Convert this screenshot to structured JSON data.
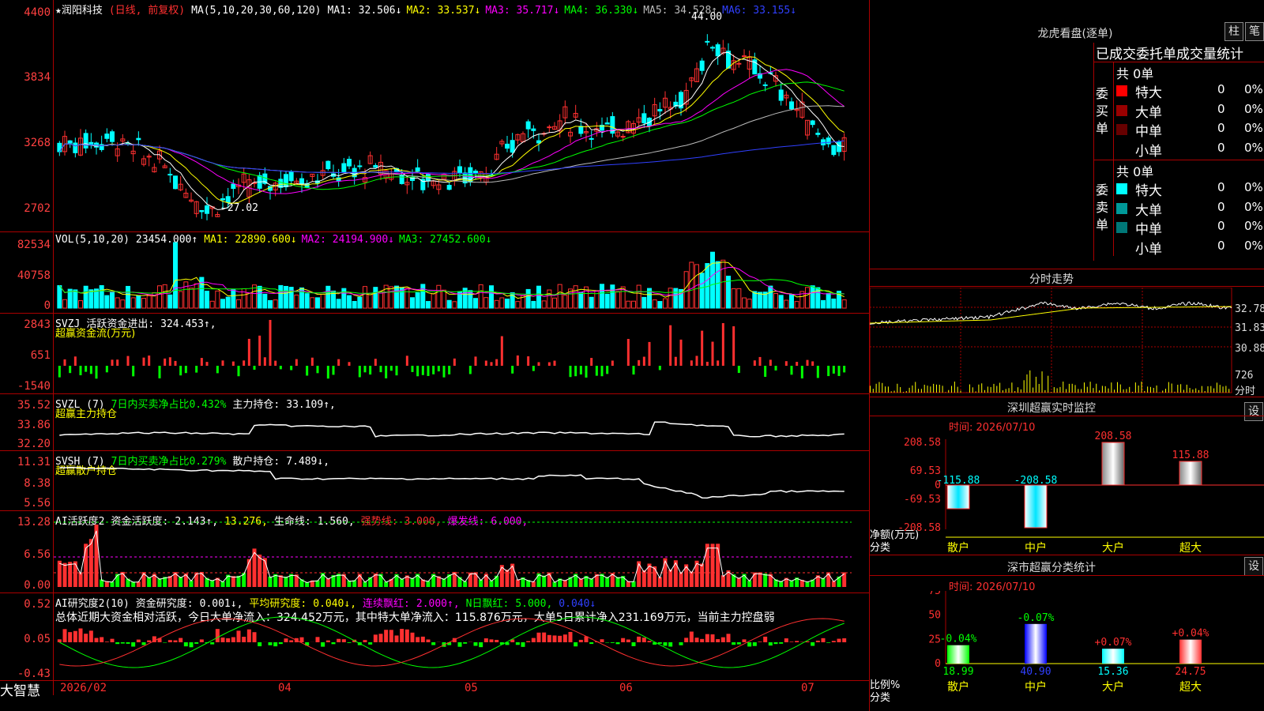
{
  "stock": {
    "name": "★润阳科技",
    "mode": "(日线, 前复权)",
    "ma_header": "MA(5,10,20,30,60,120)",
    "ma": [
      {
        "label": "MA1:",
        "value": "32.506↓",
        "color": "#ffffff"
      },
      {
        "label": "MA2:",
        "value": "33.537↓",
        "color": "#ffff00"
      },
      {
        "label": "MA3:",
        "value": "35.717↓",
        "color": "#ff00ff"
      },
      {
        "label": "MA4:",
        "value": "36.330↓",
        "color": "#00ff00"
      },
      {
        "label": "MA5:",
        "value": "34.528↑",
        "color": "#bbbbbb"
      },
      {
        "label": "MA6:",
        "value": "33.155↓",
        "color": "#3040ff"
      }
    ],
    "high_mark": "44.00",
    "low_mark": "←27.02",
    "price_ticks": [
      "4400",
      "3834",
      "3268",
      "2702"
    ]
  },
  "vol": {
    "header": "VOL(5,10,20)",
    "value": "23454.000↑",
    "ma": [
      {
        "label": "MA1:",
        "value": "22890.600↓",
        "color": "#ffff00"
      },
      {
        "label": "MA2:",
        "value": "24194.900↓",
        "color": "#ff00ff"
      },
      {
        "label": "MA3:",
        "value": "27452.600↓",
        "color": "#00ff00"
      }
    ],
    "ticks": [
      "82534",
      "40758",
      "0"
    ]
  },
  "svzj": {
    "header": "SVZJ",
    "label": "活跃资金进出:",
    "value": "324.453↑,",
    "subtitle": "超赢资金流(万元)",
    "ticks": [
      "2843",
      "651",
      "-1540"
    ]
  },
  "svzl": {
    "header": "SVZL (7)",
    "label1": "7日内买卖净占比0.432%",
    "label2": "主力持仓:",
    "value": "33.109↑,",
    "subtitle": "超赢主力持仓",
    "ticks": [
      "35.52",
      "33.86",
      "32.20"
    ]
  },
  "svsh": {
    "header": "SVSH (7)",
    "label1": "7日内买卖净占比0.279%",
    "label2": "散户持仓:",
    "value": "7.489↓,",
    "subtitle": "超赢散户持仓",
    "ticks": [
      "11.31",
      "8.38",
      "5.56"
    ]
  },
  "ai1": {
    "header": "AI活跃度2",
    "label": "资金活跃度:",
    "v1": "2.143↑,",
    "v2": "13.276,",
    "label3": "生命线:",
    "v3": "1.560,",
    "label4": "强势线:",
    "v4": "3.000,",
    "label5": "爆发线:",
    "v5": "6.000,",
    "ticks": [
      "13.28",
      "6.56",
      "0.00"
    ]
  },
  "ai2": {
    "header": "AI研究度2(10)",
    "label": "资金研究度:",
    "v1": "0.001↓,",
    "label2": "平均研究度:",
    "v2": "0.040↓,",
    "label3": "连续飘红:",
    "v3": "2.000↑,",
    "label4": "N日飘红:",
    "v4": "5.000,",
    "v5": "0.040↓",
    "summary": "总体近期大资金相对活跃，今日大单净流入：324.452万元，其中特大单净流入：115.876万元，大单5日累计净入231.169万元，当前主力控盘弱",
    "ticks": [
      "0.52",
      "0.05",
      "-0.43"
    ]
  },
  "footer": {
    "brand": "大智慧",
    "months": [
      "2026/02",
      "04",
      "05",
      "06",
      "07"
    ]
  },
  "right": {
    "top_title": "龙虎看盘(逐单)",
    "btn_zhu": "柱",
    "btn_bi": "笔",
    "table_title": "已成交委托单成交量统计",
    "buy_label": "委买单",
    "sell_label": "委卖单",
    "buy_total": "共 0单",
    "sell_total": "共 0单",
    "buy_rows": [
      {
        "name": "特大",
        "v": "0",
        "p": "0%",
        "color": "#ff0000"
      },
      {
        "name": "大单",
        "v": "0",
        "p": "0%",
        "color": "#990000"
      },
      {
        "name": "中单",
        "v": "0",
        "p": "0%",
        "color": "#660000"
      },
      {
        "name": "小单",
        "v": "0",
        "p": "0%",
        "color": ""
      }
    ],
    "sell_rows": [
      {
        "name": "特大",
        "v": "0",
        "p": "0%",
        "color": "#00ffff"
      },
      {
        "name": "大单",
        "v": "0",
        "p": "0%",
        "color": "#009999"
      },
      {
        "name": "中单",
        "v": "0",
        "p": "0%",
        "color": "#007777"
      },
      {
        "name": "小单",
        "v": "0",
        "p": "0%",
        "color": ""
      }
    ],
    "intraday_title": "分时走势",
    "intraday_ticks": [
      "32.78",
      "31.83",
      "30.88",
      "726",
      "分时"
    ],
    "monitor_title": "深圳超赢实时监控",
    "monitor_btn": "设",
    "monitor_time": "时间: 2026/07/10",
    "monitor_ylabel": "净额(万元)",
    "monitor_xlabel": "分类",
    "class_title": "深市超赢分类统计",
    "class_btn": "设",
    "class_time": "时间: 2026/07/10",
    "class_ylabel": "比例%",
    "class_xlabel": "分类"
  },
  "chart_data": [
    {
      "type": "bar",
      "title": "深圳超赢实时监控",
      "ylabel": "净额(万元)",
      "xlabel": "分类",
      "categories": [
        "散户",
        "中户",
        "大户",
        "超大"
      ],
      "values": [
        -115.88,
        -208.58,
        208.58,
        115.88
      ],
      "labels": [
        "-115.88",
        "-208.58",
        "208.58",
        "115.88"
      ],
      "yticks": [
        "208.58",
        "69.53",
        "0",
        "-69.53",
        "-208.58"
      ],
      "ylim": [
        -208.58,
        208.58
      ]
    },
    {
      "type": "bar",
      "title": "深市超赢分类统计",
      "ylabel": "比例%",
      "xlabel": "分类",
      "categories": [
        "散户",
        "中户",
        "大户",
        "超大"
      ],
      "values": [
        18.99,
        40.9,
        15.36,
        24.75
      ],
      "changes": [
        "-0.04%",
        "-0.07%",
        "+0.07%",
        "+0.04%"
      ],
      "labels": [
        "18.99",
        "40.90",
        "15.36",
        "24.75"
      ],
      "yticks": [
        "75",
        "50",
        "25",
        "0"
      ],
      "ylim": [
        0,
        75
      ]
    }
  ]
}
